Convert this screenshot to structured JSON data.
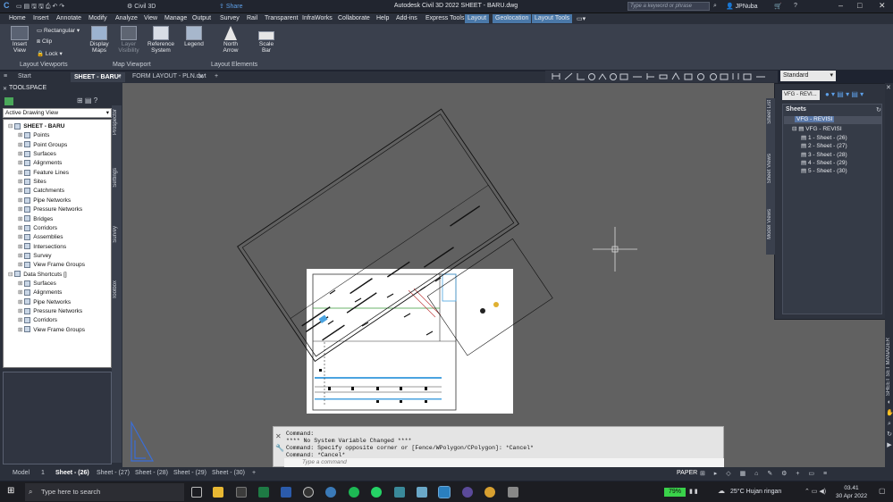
{
  "titlebar": {
    "app_name": "Civil 3D",
    "workspace": "Civil 3D",
    "share": "Share",
    "title": "Autodesk Civil 3D 2022    SHEET - BARU.dwg",
    "search_placeholder": "Type a keyword or phrase",
    "user": "JPNuba"
  },
  "ribbon_tabs": [
    "Home",
    "Insert",
    "Annotate",
    "Modify",
    "Analyze",
    "View",
    "Manage",
    "Output",
    "Survey",
    "Rail",
    "Transparent",
    "InfraWorks",
    "Collaborate",
    "Help",
    "Add-ins",
    "Express Tools",
    "Layout",
    "Geolocation",
    "Layout Tools"
  ],
  "ribbon": {
    "insert_view": "Insert View",
    "rectangular": "Rectangular",
    "clip": "Clip",
    "lock": "Lock",
    "display_maps": [
      "Display",
      "Maps"
    ],
    "layer_visibility": [
      "Layer",
      "Visibility"
    ],
    "reference_system": [
      "Reference",
      "System"
    ],
    "legend": "Legend",
    "north_arrow": [
      "North",
      "Arrow"
    ],
    "scale_bar": [
      "Scale",
      "Bar"
    ],
    "groups": [
      "Layout Viewports",
      "Map Viewport",
      "Layout Elements"
    ]
  },
  "doc_tabs": [
    "Start",
    "SHEET - BARU*",
    "FORM LAYOUT - PLN.dwt"
  ],
  "properties": {
    "text_style": "Standard"
  },
  "toolspace": {
    "header": "TOOLSPACE",
    "view": "Active Drawing View",
    "tree": [
      {
        "label": "SHEET - BARU",
        "level": 0,
        "bold": true
      },
      {
        "label": "Points",
        "level": 1
      },
      {
        "label": "Point Groups",
        "level": 1
      },
      {
        "label": "Surfaces",
        "level": 1
      },
      {
        "label": "Alignments",
        "level": 1
      },
      {
        "label": "Feature Lines",
        "level": 1
      },
      {
        "label": "Sites",
        "level": 1
      },
      {
        "label": "Catchments",
        "level": 1
      },
      {
        "label": "Pipe Networks",
        "level": 1
      },
      {
        "label": "Pressure Networks",
        "level": 1
      },
      {
        "label": "Bridges",
        "level": 1
      },
      {
        "label": "Corridors",
        "level": 1
      },
      {
        "label": "Assemblies",
        "level": 1
      },
      {
        "label": "Intersections",
        "level": 1
      },
      {
        "label": "Survey",
        "level": 1
      },
      {
        "label": "View Frame Groups",
        "level": 1
      },
      {
        "label": "Data Shortcuts []",
        "level": 0
      },
      {
        "label": "Surfaces",
        "level": 1
      },
      {
        "label": "Alignments",
        "level": 1
      },
      {
        "label": "Pipe Networks",
        "level": 1
      },
      {
        "label": "Pressure Networks",
        "level": 1
      },
      {
        "label": "Corridors",
        "level": 1
      },
      {
        "label": "View Frame Groups",
        "level": 1
      }
    ],
    "side_tabs": [
      "Prospector",
      "Settings",
      "Survey",
      "Toolbox"
    ]
  },
  "sheet_set": {
    "dropdown": "VFG - REVI...",
    "header": "Sheets",
    "root": "VFG - REVISI",
    "group": "VFG - REVISI",
    "sheets": [
      "1 - Sheet - (26)",
      "2 - Sheet - (27)",
      "3 - Sheet - (28)",
      "4 - Sheet - (29)",
      "5 - Sheet - (30)"
    ],
    "side_tabs": [
      "Sheet List",
      "Sheet Views",
      "Model Views"
    ],
    "title": "SHEET SET MANAGER"
  },
  "command": {
    "lines": [
      "Command:",
      "**** No System Variable Changed ****",
      "Command: Specify opposite corner or [Fence/WPolygon/CPolygon]: *Cancel*",
      "Command: *Cancel*"
    ],
    "placeholder": "Type a command"
  },
  "layout_tabs": [
    "Model",
    "1",
    "Sheet - (26)",
    "Sheet - (27)",
    "Sheet - (28)",
    "Sheet - (29)",
    "Sheet - (30)"
  ],
  "status": {
    "space": "PAPER"
  },
  "taskbar": {
    "search": "Type here to search",
    "battery": "79%",
    "weather": "25°C  Hujan ringan",
    "time": "03.41",
    "date": "30 Apr 2022"
  }
}
